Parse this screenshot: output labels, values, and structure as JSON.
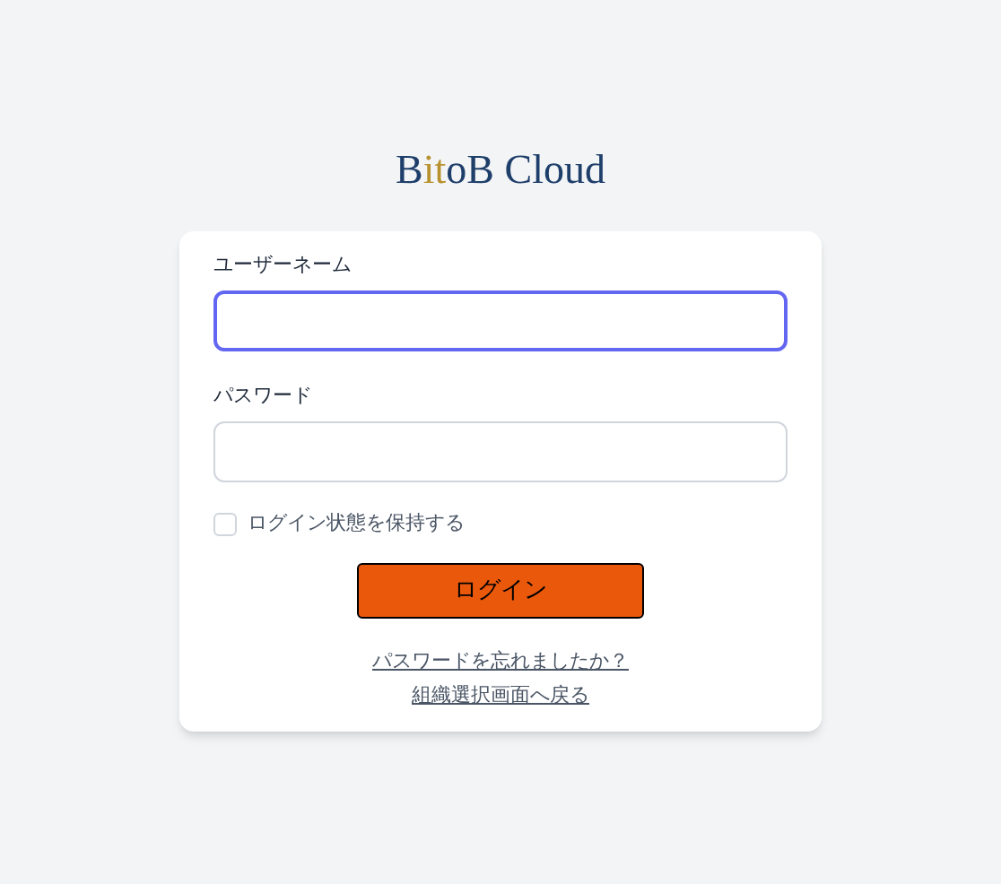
{
  "logo": {
    "parts": [
      {
        "text": "B",
        "color": "#1f3f6b"
      },
      {
        "text": "it",
        "color": "#b8922e"
      },
      {
        "text": "oB Cloud",
        "color": "#1f3f6b"
      }
    ]
  },
  "form": {
    "fields": [
      {
        "label": "ユーザーネーム",
        "focused": true
      },
      {
        "label": "パスワード",
        "focused": false
      }
    ],
    "remember": {
      "label": "ログイン状態を保持する",
      "checked": false
    },
    "submit": "ログイン",
    "links": [
      "パスワードを忘れましたか？",
      "組織選択画面へ戻る"
    ]
  }
}
